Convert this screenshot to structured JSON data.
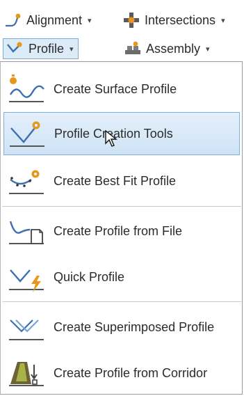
{
  "ribbon": {
    "alignment_label": "Alignment",
    "intersections_label": "Intersections",
    "profile_label": "Profile",
    "assembly_label": "Assembly",
    "caret": "▾"
  },
  "menu": {
    "items": [
      {
        "label": "Create Surface Profile",
        "icon": "surface-profile-icon"
      },
      {
        "label": "Profile Creation Tools",
        "icon": "profile-creation-tools-icon",
        "state": "hover"
      },
      {
        "label": "Create Best Fit Profile",
        "icon": "best-fit-profile-icon"
      },
      {
        "label": "Create Profile from File",
        "icon": "profile-from-file-icon"
      },
      {
        "label": "Quick Profile",
        "icon": "quick-profile-icon"
      },
      {
        "label": "Create Superimposed Profile",
        "icon": "superimposed-profile-icon"
      },
      {
        "label": "Create Profile from Corridor",
        "icon": "profile-from-corridor-icon"
      }
    ]
  },
  "colors": {
    "hover_fill": "#cfe3f6",
    "hover_border": "#7eaedb",
    "accent_orange": "#e8961e",
    "icon_blue": "#3d6fb0"
  }
}
